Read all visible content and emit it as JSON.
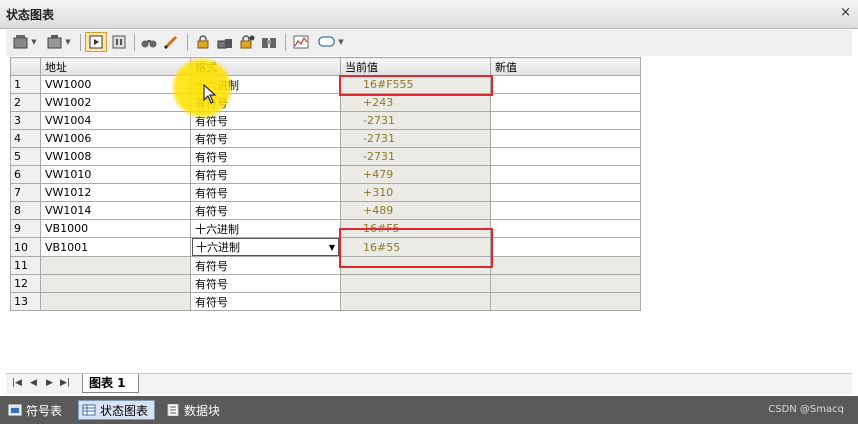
{
  "window": {
    "title": "状态图表",
    "close_glyph": "×"
  },
  "toolbar": {
    "icons": [
      "insert-row-icon",
      "delete-row-icon",
      "run-trend-icon",
      "pause-icon",
      "binoculars-icon",
      "pencil-icon",
      "lock-icon",
      "unlock-icon",
      "force-icon",
      "read-all-icon",
      "chart-icon",
      "speech-bubble-icon"
    ]
  },
  "table": {
    "headers": [
      "",
      "地址",
      "格式",
      "当前值",
      "新值"
    ],
    "rows": [
      {
        "n": "1",
        "addr": "VW1000",
        "fmt": "十六进制",
        "cur": "16#F555",
        "new": ""
      },
      {
        "n": "2",
        "addr": "VW1002",
        "fmt": "有符号",
        "cur": "+243",
        "new": ""
      },
      {
        "n": "3",
        "addr": "VW1004",
        "fmt": "有符号",
        "cur": "-2731",
        "new": ""
      },
      {
        "n": "4",
        "addr": "VW1006",
        "fmt": "有符号",
        "cur": "-2731",
        "new": ""
      },
      {
        "n": "5",
        "addr": "VW1008",
        "fmt": "有符号",
        "cur": "-2731",
        "new": ""
      },
      {
        "n": "6",
        "addr": "VW1010",
        "fmt": "有符号",
        "cur": "+479",
        "new": ""
      },
      {
        "n": "7",
        "addr": "VW1012",
        "fmt": "有符号",
        "cur": "+310",
        "new": ""
      },
      {
        "n": "8",
        "addr": "VW1014",
        "fmt": "有符号",
        "cur": "+489",
        "new": ""
      },
      {
        "n": "9",
        "addr": "VB1000",
        "fmt": "十六进制",
        "cur": "16#F5",
        "new": ""
      },
      {
        "n": "10",
        "addr": "VB1001",
        "fmt": "十六进制",
        "cur": "16#55",
        "new": ""
      },
      {
        "n": "11",
        "addr": "",
        "fmt": "有符号",
        "cur": "",
        "new": ""
      },
      {
        "n": "12",
        "addr": "",
        "fmt": "有符号",
        "cur": "",
        "new": ""
      },
      {
        "n": "13",
        "addr": "",
        "fmt": "有符号",
        "cur": "",
        "new": ""
      }
    ]
  },
  "sheet_nav": [
    "|◀",
    "◀",
    "▶",
    "▶|"
  ],
  "sheet_tab": "图表 1",
  "bottom_tabs": [
    "符号表",
    "状态图表",
    "数据块"
  ],
  "credit": "CSDN @Smacq"
}
